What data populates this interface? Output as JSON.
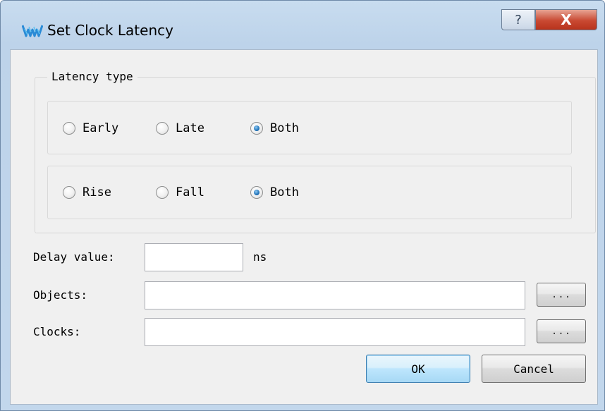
{
  "window": {
    "title": "Set Clock Latency",
    "help_glyph": "?",
    "close_glyph": "X",
    "app_icon": "gowin-logo-icon"
  },
  "latency_group": {
    "title": "Latency type",
    "row1": {
      "options": [
        "Early",
        "Late",
        "Both"
      ],
      "selected": "Both"
    },
    "row2": {
      "options": [
        "Rise",
        "Fall",
        "Both"
      ],
      "selected": "Both"
    }
  },
  "fields": {
    "delay": {
      "label": "Delay value:",
      "value": "",
      "unit": "ns"
    },
    "objects": {
      "label": "Objects:",
      "value": "",
      "browse": "..."
    },
    "clocks": {
      "label": "Clocks:",
      "value": "",
      "browse": "..."
    }
  },
  "buttons": {
    "ok": "OK",
    "cancel": "Cancel"
  },
  "colors": {
    "radio_checked": "#1f72b8",
    "close_button": "#c94932",
    "titlebar": "#c8dcef"
  }
}
